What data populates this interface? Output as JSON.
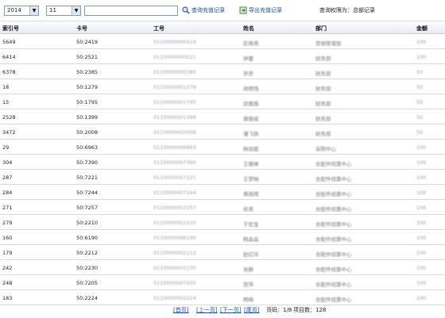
{
  "filters": {
    "year": "2014",
    "month": "11",
    "keyword_value": ""
  },
  "actions": {
    "query_label": "查询充值记录",
    "export_label": "导出充值记录",
    "query_icon": "search-icon",
    "export_icon": "export-icon"
  },
  "scope_text": "查询权限为：总部记录",
  "table": {
    "headers": [
      "索引号",
      "卡号",
      "工号",
      "姓名",
      "部门",
      "金额"
    ],
    "rows": [
      [
        "5649",
        "50:2419",
        "0110000000419",
        "彭晓燕",
        "营销管理部",
        "100"
      ],
      [
        "6414",
        "50:2521",
        "0110000000521",
        "钟蕾",
        "财务部",
        "100"
      ],
      [
        "6378",
        "50:2385",
        "0110000000385",
        "罗彦",
        "财务部",
        "50"
      ],
      [
        "18",
        "50:1279",
        "0110000001279",
        "胡德强",
        "财务部",
        "50"
      ],
      [
        "15",
        "50:1795",
        "0110000001795",
        "邱雅茜",
        "财务部",
        "50"
      ],
      [
        "2528",
        "50:1399",
        "0110000001399",
        "唐振威",
        "财务部",
        "50"
      ],
      [
        "3472",
        "50:2008",
        "0110000002008",
        "潘飞扬",
        "财务部",
        "50"
      ],
      [
        "29",
        "50:6963",
        "0110000006963",
        "杨佳妮",
        "采购中心",
        "100"
      ],
      [
        "304",
        "50:7390",
        "0110000007390",
        "王雅琳",
        "合配件结算中心",
        "100"
      ],
      [
        "287",
        "50:7221",
        "0110000007221",
        "王梦梅",
        "合配件结算中心",
        "100"
      ],
      [
        "284",
        "50:7244",
        "0110000007244",
        "黄雨晴",
        "合配件结算中心",
        "100"
      ],
      [
        "271",
        "50:7257",
        "0110000007257",
        "徐青",
        "合配件结算中心",
        "100"
      ],
      [
        "279",
        "50:2210",
        "0110000002210",
        "于宏宝",
        "合配件结算中心",
        "100"
      ],
      [
        "160",
        "50:6190",
        "0110000006190",
        "韩晶晶",
        "合配件结算中心",
        "100"
      ],
      [
        "179",
        "50:2212",
        "0110000002212",
        "赵红玲",
        "合配件结算中心",
        "100"
      ],
      [
        "242",
        "50:2230",
        "0110000002230",
        "张静",
        "合配件结算中心",
        "100"
      ],
      [
        "248",
        "50:7205",
        "0110000007205",
        "贺萍",
        "合配件结算中心",
        "100"
      ],
      [
        "183",
        "50:2224",
        "0110000002224",
        "韩梅",
        "合配件结算中心",
        "100"
      ]
    ]
  },
  "pager": {
    "first": "[首页]",
    "prev": "[上一页]",
    "next": "[下一页]",
    "last": "[尾页]",
    "page_label": "页码：1/8",
    "count_label": "项目数：128"
  }
}
